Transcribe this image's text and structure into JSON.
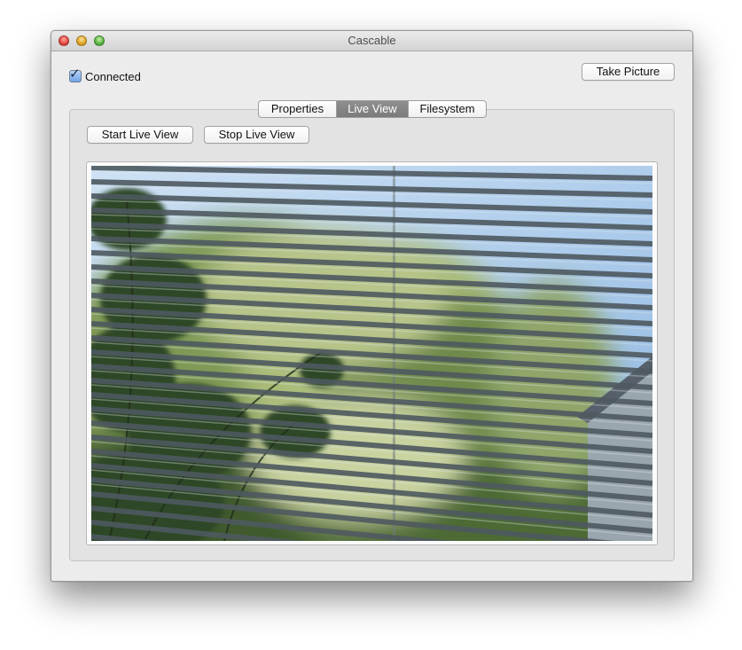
{
  "window": {
    "title": "Cascable"
  },
  "connection": {
    "label": "Connected",
    "checked": true
  },
  "toolbar": {
    "take_picture_label": "Take Picture"
  },
  "tabs": [
    {
      "label": "Properties",
      "selected": false
    },
    {
      "label": "Live View",
      "selected": true
    },
    {
      "label": "Filesystem",
      "selected": false
    }
  ],
  "live_view": {
    "start_label": "Start Live View",
    "stop_label": "Stop Live View"
  },
  "colors": {
    "selected_tab": "#848484",
    "window_bg": "#ececec"
  }
}
